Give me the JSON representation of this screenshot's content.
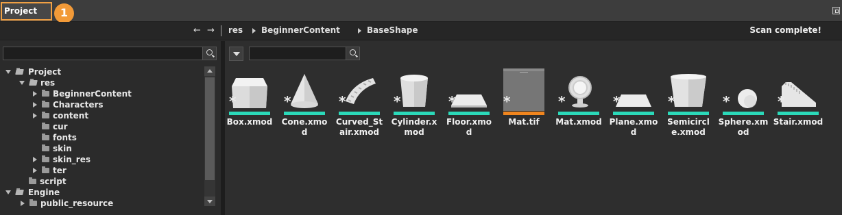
{
  "window": {
    "tab_title": "Project",
    "callout_number": "1"
  },
  "pathbar": {
    "back": "←",
    "forward": "→",
    "crumbs": [
      "res",
      "BeginnerContent",
      "BaseShape"
    ],
    "status": "Scan complete!"
  },
  "tree": {
    "items": [
      {
        "label": "Project",
        "state": "open"
      },
      {
        "label": "res",
        "state": "open"
      },
      {
        "label": "BeginnerContent",
        "state": "closed"
      },
      {
        "label": "Characters",
        "state": "closed"
      },
      {
        "label": "content",
        "state": "closed"
      },
      {
        "label": "cur",
        "state": "leaf"
      },
      {
        "label": "fonts",
        "state": "leaf"
      },
      {
        "label": "skin",
        "state": "leaf"
      },
      {
        "label": "skin_res",
        "state": "closed"
      },
      {
        "label": "ter",
        "state": "closed"
      },
      {
        "label": "script",
        "state": "leaf"
      },
      {
        "label": "Engine",
        "state": "open"
      },
      {
        "label": "public_resource",
        "state": "closed"
      }
    ]
  },
  "assets": [
    {
      "label": "Box.xmod",
      "shape": "box",
      "bar": "teal"
    },
    {
      "label": "Cone.xmod",
      "shape": "cone",
      "bar": "teal"
    },
    {
      "label": "Curved_Stair.xmod",
      "shape": "curved-stair",
      "bar": "teal"
    },
    {
      "label": "Cylinder.xmod",
      "shape": "cylinder",
      "bar": "teal"
    },
    {
      "label": "Floor.xmod",
      "shape": "floor",
      "bar": "teal"
    },
    {
      "label": "Mat.tif",
      "shape": "texture",
      "bar": "orange"
    },
    {
      "label": "Mat.xmod",
      "shape": "material-ball",
      "bar": "teal"
    },
    {
      "label": "Plane.xmod",
      "shape": "plane",
      "bar": "teal"
    },
    {
      "label": "Semicircle.xmod",
      "shape": "semicircle",
      "bar": "teal"
    },
    {
      "label": "Sphere.xmod",
      "shape": "sphere",
      "bar": "teal"
    },
    {
      "label": "Stair.xmod",
      "shape": "stair",
      "bar": "teal"
    }
  ],
  "colors": {
    "highlight": "#f0a044",
    "teal_bar": "#2bd9b9",
    "orange_bar": "#f0851e"
  }
}
